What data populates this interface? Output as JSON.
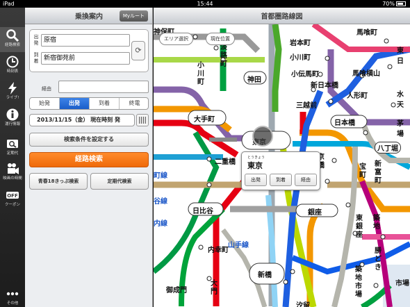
{
  "status": {
    "device": "iPad",
    "time": "15:44",
    "battery": "70%"
  },
  "rail": [
    {
      "label": "経路検索",
      "icon": "search-icon"
    },
    {
      "label": "時刻表",
      "icon": "clock-icon"
    },
    {
      "label": "ライブ!",
      "icon": "lightning-icon"
    },
    {
      "label": "運行情報",
      "icon": "info-icon"
    },
    {
      "label": "定期代",
      "icon": "pass-icon"
    },
    {
      "label": "映画の時間",
      "icon": "movie-camera-icon"
    },
    {
      "label": "クーポン",
      "icon": "coupon-icon"
    },
    {
      "label": "その他",
      "icon": "more-icon"
    }
  ],
  "panel": {
    "title": "乗換案内",
    "myroute": "Myルート",
    "from_label": "出発",
    "to_label": "到着",
    "from_value": "原宿",
    "to_value": "新宿御苑前",
    "via_label": "経由",
    "modes": [
      "始発",
      "出発",
      "到着",
      "終電"
    ],
    "datetime": "2013/11/15（金） 現在時刻 発",
    "conditions_button": "検索条件を設定する",
    "search_button": "経路検索",
    "seishun_button": "青春18きっぷ検索",
    "teikidai_button": "定期代検索"
  },
  "map": {
    "title": "首都圏路線図",
    "area_button": "エリア選択",
    "location_button": "現在位置",
    "popup": {
      "kana": "とうきょう",
      "name": "東京",
      "buttons": [
        "出発",
        "到着",
        "経由"
      ]
    },
    "stations": {
      "jimbocho": "神保町",
      "iwamotocho": "岩本町",
      "bakurocho": "馬喰町",
      "awajicho": "淡路町",
      "ogawamachi": "小川町",
      "ogawamachi2": "小川町",
      "kanda": "神田",
      "kodemmacho": "小伝馬町",
      "higashi": "東日",
      "bakuroyokoyama": "馬喰横山",
      "shinnihombashi": "新日本橋",
      "ningyocho": "人形町",
      "suiten": "水天",
      "mitsukoshimae": "三越前",
      "otemachi": "大手町",
      "nihombashi": "日本橋",
      "kayaba": "茅場",
      "tokyo": "東京",
      "hatchobori": "八丁堀",
      "nijubashi": "二重橋",
      "kyobashi": "京橋",
      "takara": "宝町",
      "shintomicho": "新富町",
      "hibiya": "日比谷",
      "ginza": "銀座",
      "higashiginza": "東銀座",
      "tsukiji": "築地",
      "uchisaiwaicho": "内幸町",
      "kachidoki": "勝どき",
      "shimbashi": "新橋",
      "onarimon": "御成門",
      "daimon": "大門",
      "shiodome": "汐留",
      "shijo": "築地市場",
      "ichiba": "市場"
    },
    "line_labels": {
      "a": "町線",
      "b": "谷線",
      "c": "内線",
      "yamanote": "山手線"
    }
  }
}
